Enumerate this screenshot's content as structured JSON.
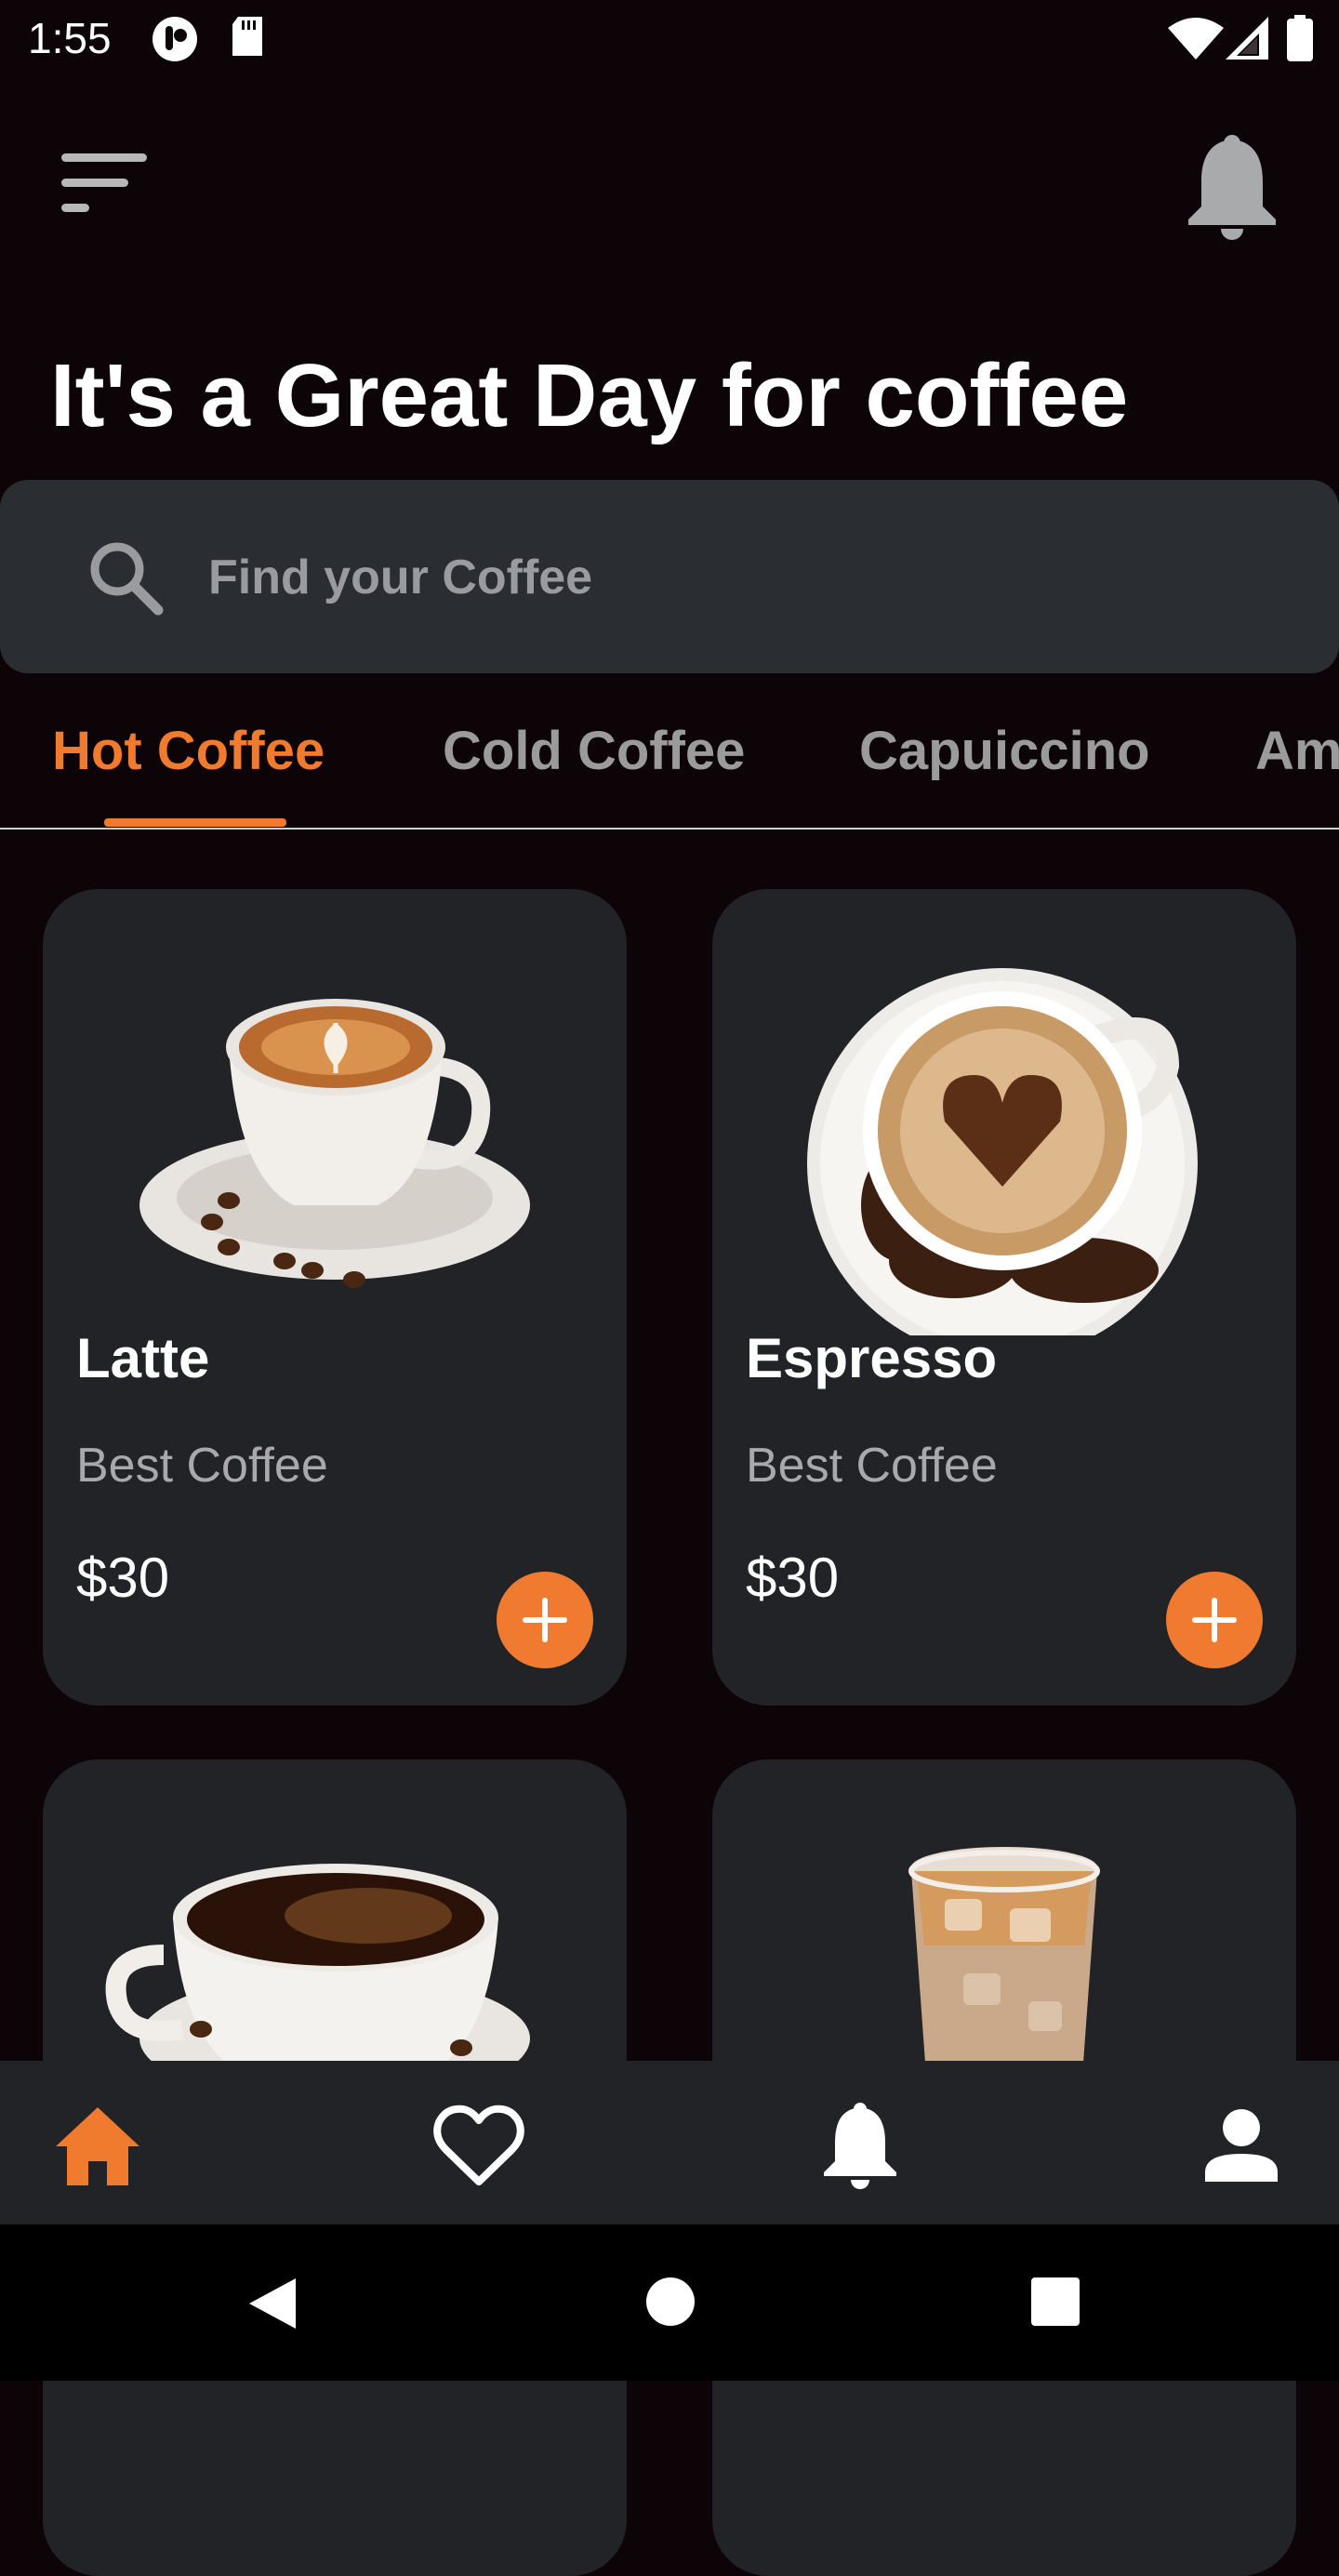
{
  "status_bar": {
    "time": "1:55",
    "icons": [
      "podcast-icon",
      "sd-card-icon",
      "wifi-icon",
      "signal-icon",
      "battery-icon"
    ]
  },
  "header": {
    "menu_icon": "menu-icon",
    "notification_icon": "bell-icon",
    "headline": "It's a Great Day for coffee"
  },
  "search": {
    "placeholder": "Find your Coffee",
    "value": ""
  },
  "tabs": [
    {
      "label": "Hot Coffee",
      "active": true
    },
    {
      "label": "Cold Coffee",
      "active": false
    },
    {
      "label": "Capuiccino",
      "active": false
    },
    {
      "label": "Am",
      "active": false
    }
  ],
  "products": [
    {
      "name": "Latte",
      "subtitle": "Best Coffee",
      "price": "$30",
      "image": "latte-cup-image"
    },
    {
      "name": "Espresso",
      "subtitle": "Best Coffee",
      "price": "$30",
      "image": "espresso-cup-image"
    },
    {
      "name": "",
      "subtitle": "",
      "price": "",
      "image": "black-coffee-cup-image"
    },
    {
      "name": "",
      "subtitle": "",
      "price": "",
      "image": "iced-coffee-glass-image"
    }
  ],
  "bottom_nav": {
    "items": [
      "home-icon",
      "heart-icon",
      "bell-icon",
      "person-icon"
    ],
    "active": "home-icon"
  },
  "system_nav": [
    "back-icon",
    "home-circle-icon",
    "recents-icon"
  ],
  "colors": {
    "accent": "#f07a2e",
    "background": "#0c0406",
    "card": "#222326",
    "search_bg": "#2a2d31"
  }
}
